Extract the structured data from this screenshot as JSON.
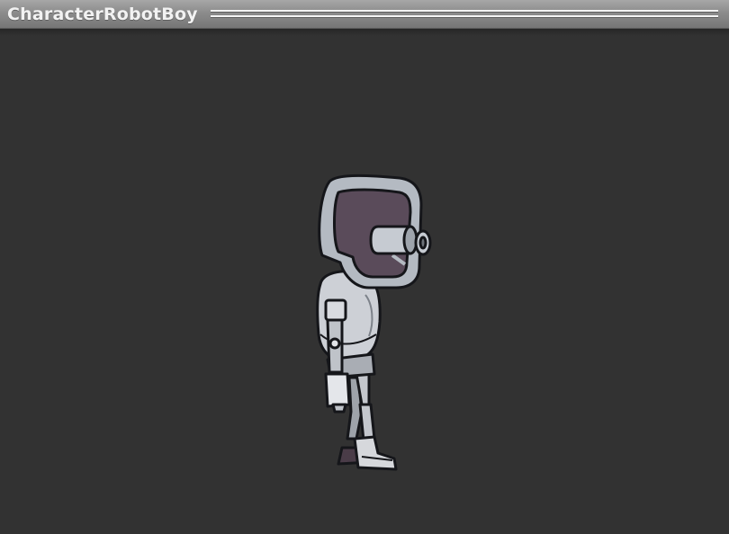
{
  "window": {
    "title": "CharacterRobotBoy"
  },
  "colors": {
    "background": "#323232",
    "titlebar": "#8c8c8c",
    "title_text": "#f2f2f2",
    "helmet": "#b4bac2",
    "visor": "#5a4b5a",
    "body_metal": "#c9ccd2",
    "outline": "#15161a"
  },
  "scene": {
    "sprite": "robot-boy-sprite"
  }
}
